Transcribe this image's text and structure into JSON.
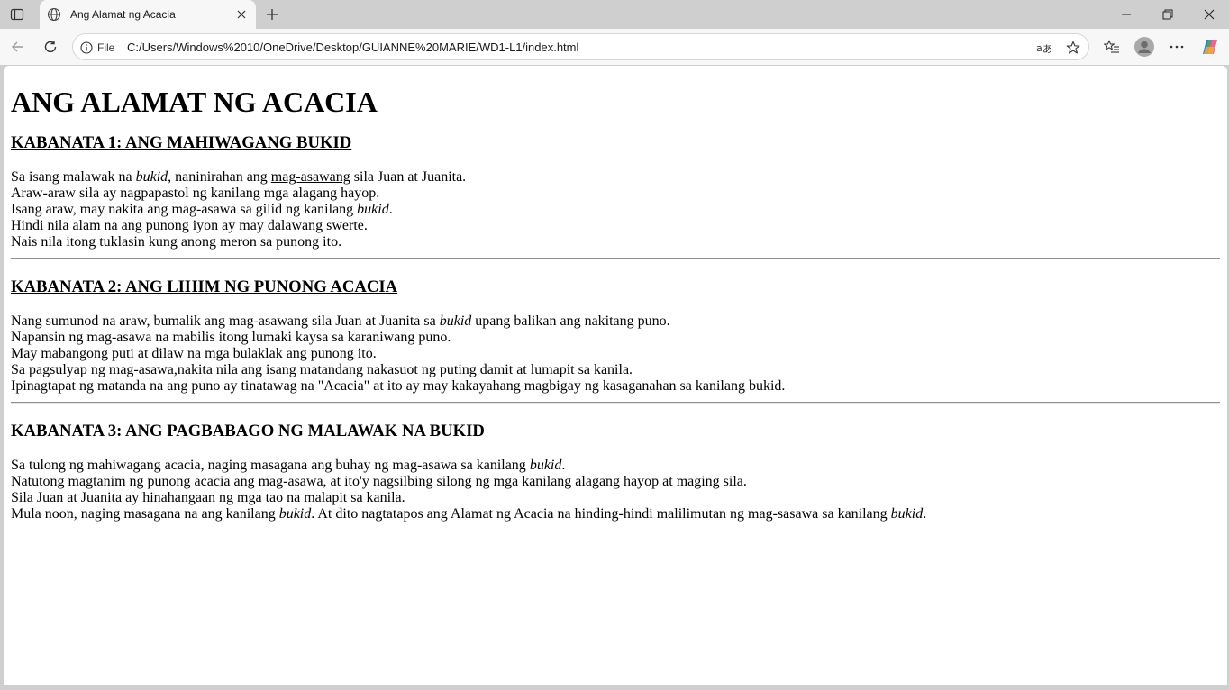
{
  "browser": {
    "tab_title": "Ang Alamat ng Acacia",
    "site_info_label": "File",
    "url": "C:/Users/Windows%2010/OneDrive/Desktop/GUIANNE%20MARIE/WD1-L1/index.html"
  },
  "page": {
    "title": "ANG ALAMAT NG ACACIA",
    "chapter1": {
      "heading": "KABANATA 1: ANG MAHIWAGANG BUKID",
      "l1_a": "Sa isang malawak na ",
      "l1_b": "bukid",
      "l1_c": ", naninirahan ang ",
      "l1_d": "mag-asawang",
      "l1_e": " sila Juan at Juanita.",
      "l2": "Araw-araw sila ay nagpapastol ng kanilang mga alagang hayop.",
      "l3_a": "Isang araw, may nakita ang mag-asawa sa gilid ng kanilang ",
      "l3_b": "bukid",
      "l3_c": ".",
      "l4": "Hindi nila alam na ang punong iyon ay may dalawang swerte.",
      "l5": "Nais nila itong tuklasin kung anong meron sa punong ito."
    },
    "chapter2": {
      "heading": "KABANATA 2: ANG LIHIM NG PUNONG ACACIA",
      "l1_a": "Nang sumunod na araw, bumalik ang mag-asawang sila Juan at Juanita sa ",
      "l1_b": "bukid",
      "l1_c": " upang balikan ang nakitang puno.",
      "l2": "Napansin ng mag-asawa na mabilis itong lumaki kaysa sa karaniwang puno.",
      "l3": "May mabangong puti at dilaw na mga bulaklak ang punong ito.",
      "l4": "Sa pagsulyap ng mag-asawa,nakita nila ang isang matandang nakasuot ng puting damit at lumapit sa kanila.",
      "l5": "Ipinagtapat ng matanda na ang puno ay tinatawag na \"Acacia\" at ito ay may kakayahang magbigay ng kasaganahan sa kanilang bukid."
    },
    "chapter3": {
      "heading": "KABANATA 3: ANG PAGBABAGO NG MALAWAK NA BUKID",
      "l1_a": "Sa tulong ng mahiwagang acacia, naging masagana ang buhay ng mag-asawa sa kanilang ",
      "l1_b": "bukid",
      "l1_c": ".",
      "l2": "Natutong magtanim ng punong acacia ang mag-asawa, at ito'y nagsilbing silong ng mga kanilang alagang hayop at maging sila.",
      "l3": "Sila Juan at Juanita ay hinahangaan ng mga tao na malapit sa kanila.",
      "l4_a": "Mula noon, naging masagana na ang kanilang ",
      "l4_b": "bukid",
      "l4_c": ". At dito nagtatapos ang Alamat ng Acacia na hinding-hindi malilimutan ng mag-sasawa sa kanilang ",
      "l4_d": "bukid",
      "l4_e": "."
    }
  },
  "icons": {
    "tab_actions": "tab-actions-icon",
    "favicon": "globe-icon",
    "tab_close": "close-icon",
    "new_tab": "plus-icon",
    "minimize": "minimize-icon",
    "restore": "restore-icon",
    "close_window": "close-window-icon",
    "back": "back-arrow-icon",
    "refresh": "refresh-icon",
    "site_info": "info-icon",
    "read_aloud": "read-aloud-icon",
    "favorite": "star-icon",
    "favorites": "favorites-icon",
    "profile": "avatar-icon",
    "more": "more-icon",
    "copilot": "copilot-icon"
  }
}
